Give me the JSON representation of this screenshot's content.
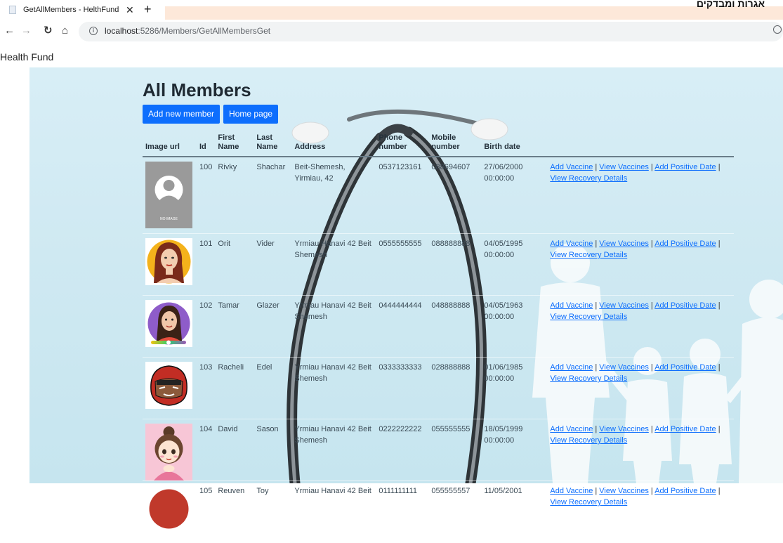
{
  "browser": {
    "tab_title": "GetAllMembers - HelthFund",
    "url_host": "localhost",
    "url_rest": ":5286/Members/GetAllMembersGet",
    "corner_text": "אגרות ומבדקים"
  },
  "brand": "Health Fund",
  "page": {
    "heading": "All Members",
    "add_button": "Add new member",
    "home_button": "Home page"
  },
  "table": {
    "headers": {
      "image": "Image url",
      "id": "Id",
      "first": "First Name",
      "last": "Last Name",
      "address": "Address",
      "phone": "Phone number",
      "mobile": "Mobile number",
      "birth": "Birth date"
    },
    "action_labels": {
      "add_vaccine": "Add Vaccine",
      "view_vaccines": "View Vaccines",
      "add_positive": "Add Positive Date",
      "view_recovery": "View Recovery Details",
      "sep": "|"
    },
    "rows": [
      {
        "avatar": "no-image",
        "no_image_text": "NO IMAGE",
        "id": "100",
        "first": "Rivky",
        "last": "Shachar",
        "address": "Beit-Shemesh, Yirmiau, 42",
        "phone": "0537123161",
        "mobile": "088694607",
        "birth": "27/06/2000 00:00:00"
      },
      {
        "avatar": "woman-portrait-red-hair",
        "id": "101",
        "first": "Orit",
        "last": "Vider",
        "address": "Yrmiau Hanavi 42 Beit Shemesh",
        "phone": "0555555555",
        "mobile": "088888888",
        "birth": "04/05/1995 00:00:00"
      },
      {
        "avatar": "woman-portrait-purple-bg",
        "id": "102",
        "first": "Tamar",
        "last": "Glazer",
        "address": "Yrmiau Hanavi 42 Beit Shemesh",
        "phone": "0444444444",
        "mobile": "048888888",
        "birth": "04/05/1963 00:00:00"
      },
      {
        "avatar": "cartoon-red-hood",
        "id": "103",
        "first": "Racheli",
        "last": "Edel",
        "address": "Yrmiau Hanavi 42 Beit Shemesh",
        "phone": "0333333333",
        "mobile": "028888888",
        "birth": "01/06/1985 00:00:00"
      },
      {
        "avatar": "cartoon-girl-pink",
        "id": "104",
        "first": "David",
        "last": "Sason",
        "address": "Yrmiau Hanavi 42 Beit Shemesh",
        "phone": "0222222222",
        "mobile": "055555555",
        "birth": "18/05/1999 00:00:00"
      },
      {
        "avatar": "red-avatar",
        "id": "105",
        "first": "Reuven",
        "last": "Toy",
        "address": "Yrmiau Hanavi 42 Beit",
        "phone": "0111111111",
        "mobile": "055555557",
        "birth": "11/05/2001"
      }
    ]
  }
}
